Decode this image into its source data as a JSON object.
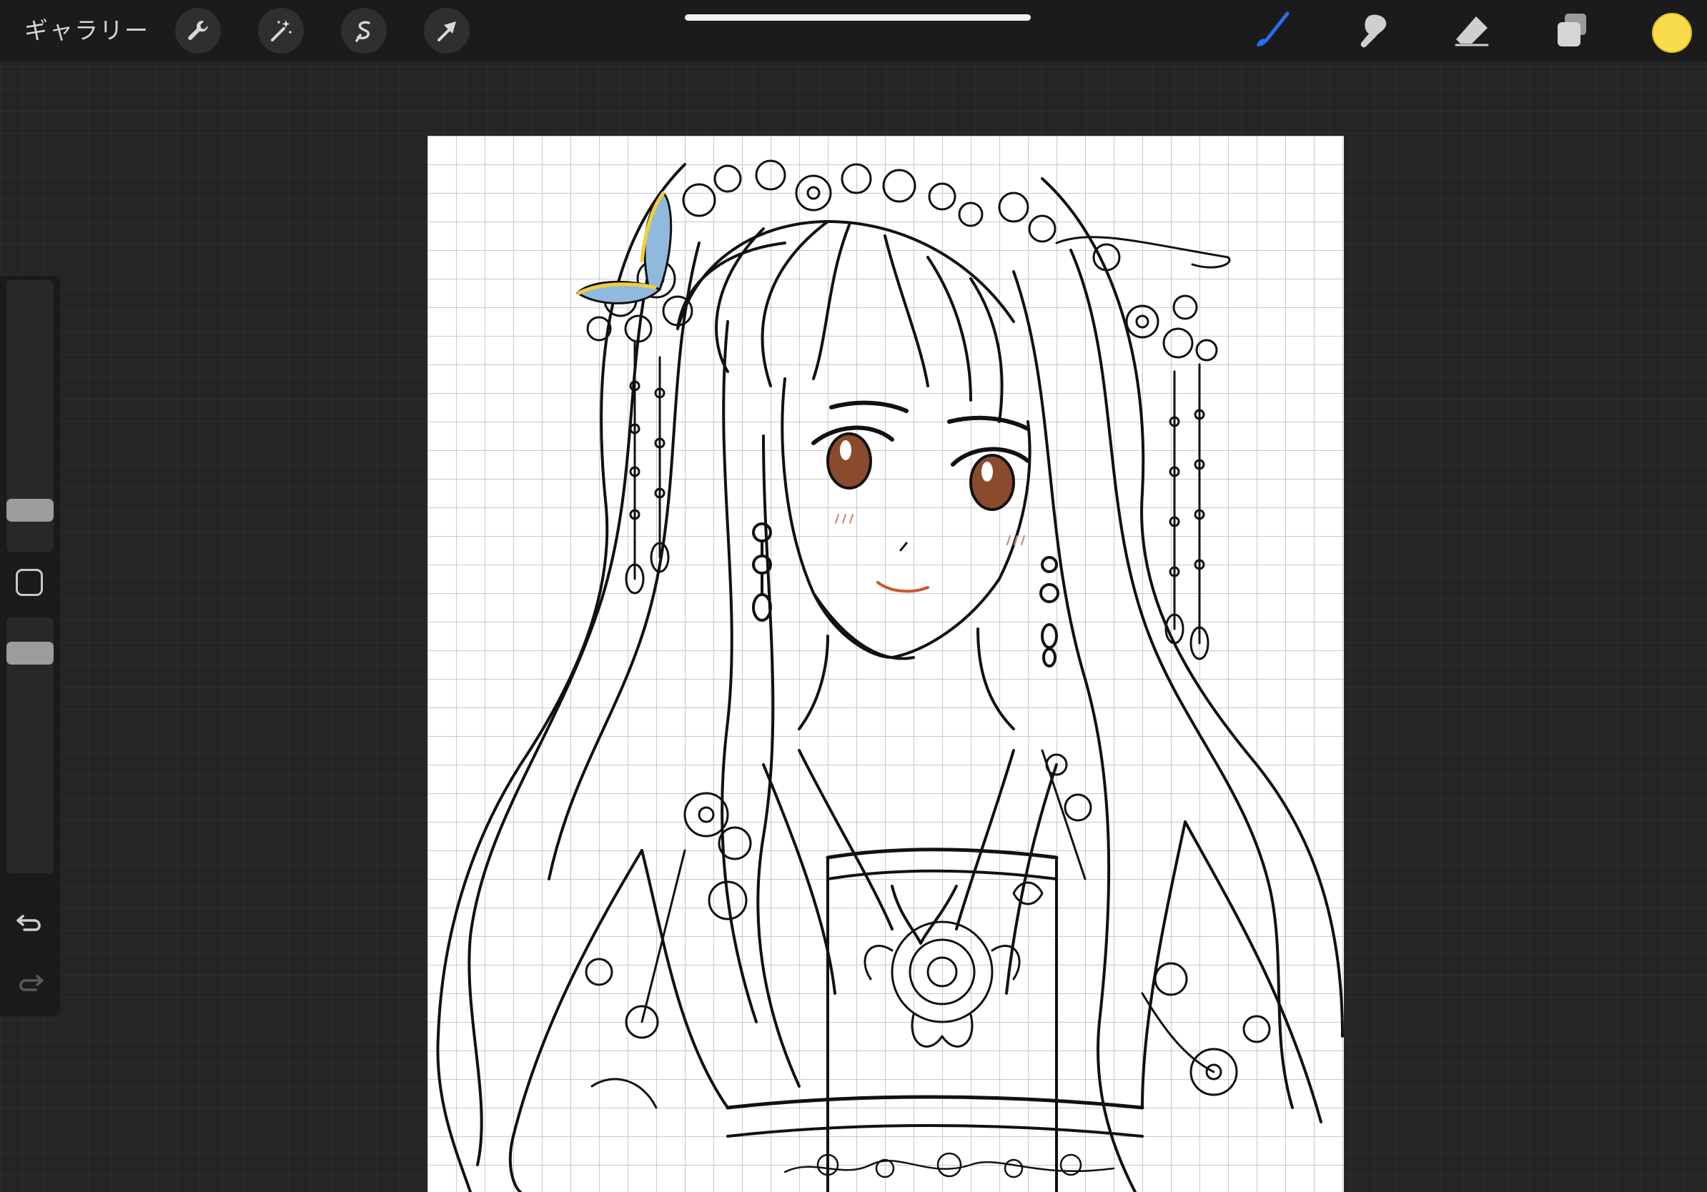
{
  "topbar": {
    "gallery_label": "ギャラリー",
    "left_tools": [
      {
        "name": "actions-wrench-icon"
      },
      {
        "name": "adjustments-wand-icon"
      },
      {
        "name": "selection-s-icon"
      },
      {
        "name": "transform-arrow-icon"
      }
    ],
    "right_tools": [
      {
        "name": "brush-icon",
        "active": true,
        "color": "#2a6cf3"
      },
      {
        "name": "smudge-icon"
      },
      {
        "name": "eraser-icon"
      },
      {
        "name": "layers-icon"
      }
    ],
    "current_color": "#f9dc4a"
  },
  "sidebar": {
    "brush_size_level": 0.38,
    "opacity_level": 0.5,
    "undo_icon": "undo-icon",
    "redo_icon": "redo-icon",
    "redo_enabled": false
  },
  "canvas": {
    "background": "#ffffff",
    "grid_color": "#c9c9c9",
    "line_color": "#111111",
    "accent_colors": {
      "butterfly_wing": "#8fb9dd",
      "butterfly_edge": "#f2cf3a",
      "eye": "#8a4a2e",
      "lips": "#d0542c"
    }
  }
}
